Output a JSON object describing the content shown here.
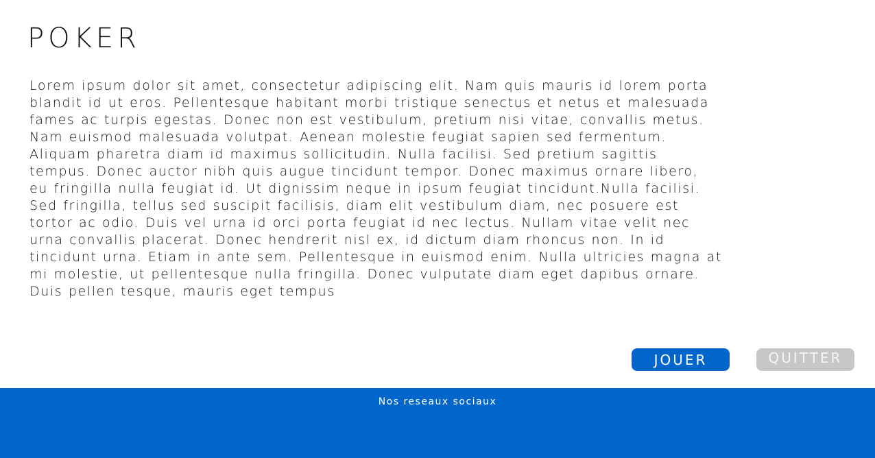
{
  "header": {
    "title": "POKER"
  },
  "main": {
    "description": "Lorem ipsum dolor sit amet, consectetur adipiscing elit. Nam quis mauris id lorem porta blandit id ut eros. Pellentesque habitant morbi tristique senectus et netus et malesuada fames ac turpis egestas. Donec non est vestibulum, pretium nisi vitae, convallis metus. Nam euismod malesuada volutpat. Aenean molestie feugiat sapien sed fermentum. Aliquam pharetra diam id maximus sollicitudin. Nulla facilisi. Sed pretium sagittis tempus. Donec auctor nibh quis augue tincidunt tempor. Donec maximus ornare libero, eu fringilla nulla feugiat id. Ut dignissim neque in ipsum feugiat tincidunt.Nulla facilisi. Sed fringilla, tellus sed suscipit facilisis, diam elit vestibulum diam, nec posuere est tortor ac odio. Duis vel urna id orci porta feugiat id nec lectus. Nullam vitae velit nec urna convallis placerat. Donec hendrerit nisl ex, id dictum diam rhoncus non. In id tincidunt urna. Etiam in ante sem. Pellentesque in euismod enim. Nulla ultricies magna at mi molestie, ut pellentesque nulla fringilla. Donec vulputate diam eget dapibus ornare. Duis pellen tesque, mauris eget tempus"
  },
  "actions": {
    "play_label": "JOUER",
    "quit_label": "QUITTER"
  },
  "footer": {
    "social_label": "Nos reseaux sociaux"
  },
  "colors": {
    "primary": "#0066cc",
    "disabled": "#c7c7c7",
    "background": "#ffffff",
    "text": "#111111"
  }
}
